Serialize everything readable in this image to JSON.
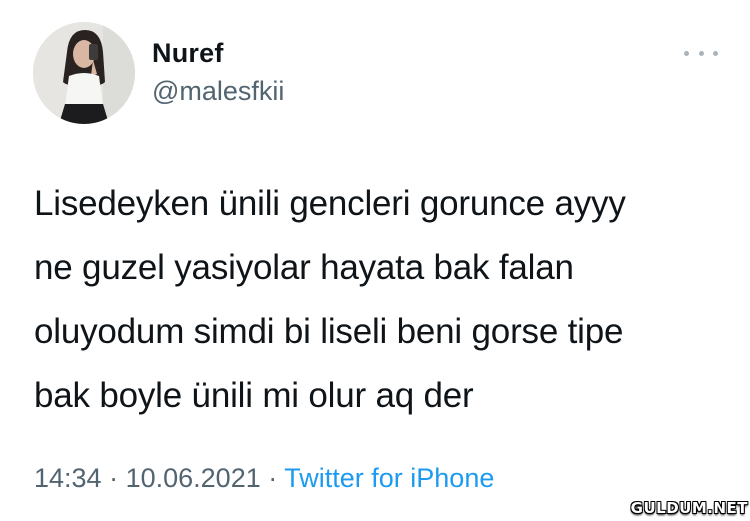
{
  "user": {
    "display_name": "Nuref",
    "handle": "@malesfkii"
  },
  "more_icon": "more-horizontal-icon",
  "tweet": {
    "lines": [
      "Lisedeyken ünili gencleri gorunce ayyy",
      "ne guzel yasiyolar hayata bak falan",
      "oluyodum simdi bi liseli beni gorse tipe",
      "bak boyle ünili mi olur aq der"
    ]
  },
  "meta": {
    "time": "14:34",
    "separator": "·",
    "date": "10.06.2021",
    "source": "Twitter for iPhone"
  },
  "watermark": "GULDUM.NET",
  "colors": {
    "text": "#0f1419",
    "secondary": "#536471",
    "link": "#1d9bf0"
  }
}
